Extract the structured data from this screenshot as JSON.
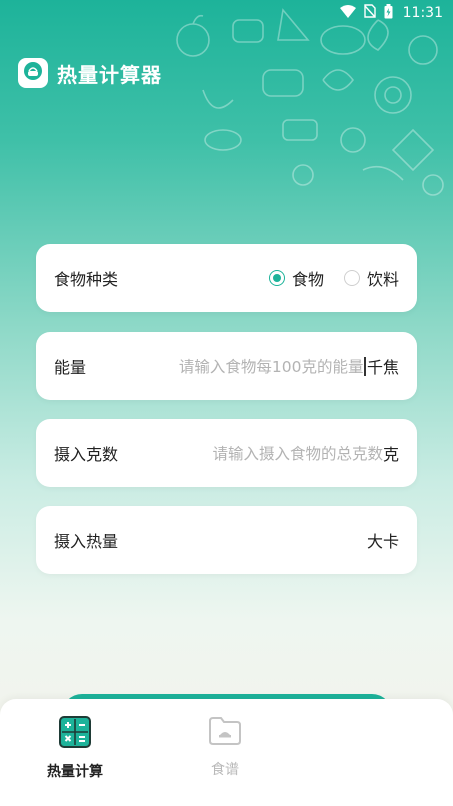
{
  "status_bar": {
    "time": "11:31"
  },
  "header": {
    "title": "热量计算器",
    "logo_icon": "bowl-icon"
  },
  "food_type": {
    "label": "食物种类",
    "options": [
      {
        "label": "食物",
        "selected": true
      },
      {
        "label": "饮料",
        "selected": false
      }
    ]
  },
  "energy": {
    "label": "能量",
    "placeholder": "请输入食物每100克的能量",
    "unit": "千焦"
  },
  "grams": {
    "label": "摄入克数",
    "placeholder": "请输入摄入食物的总克数",
    "unit": "克"
  },
  "calories": {
    "label": "摄入热量",
    "unit": "大卡"
  },
  "bottom_nav": {
    "items": [
      {
        "label": "热量计算",
        "icon": "calculator-icon",
        "active": true
      },
      {
        "label": "食谱",
        "icon": "folder-icon",
        "active": false
      }
    ]
  },
  "colors": {
    "accent": "#1db39a",
    "inactive": "#b8b8b8"
  }
}
